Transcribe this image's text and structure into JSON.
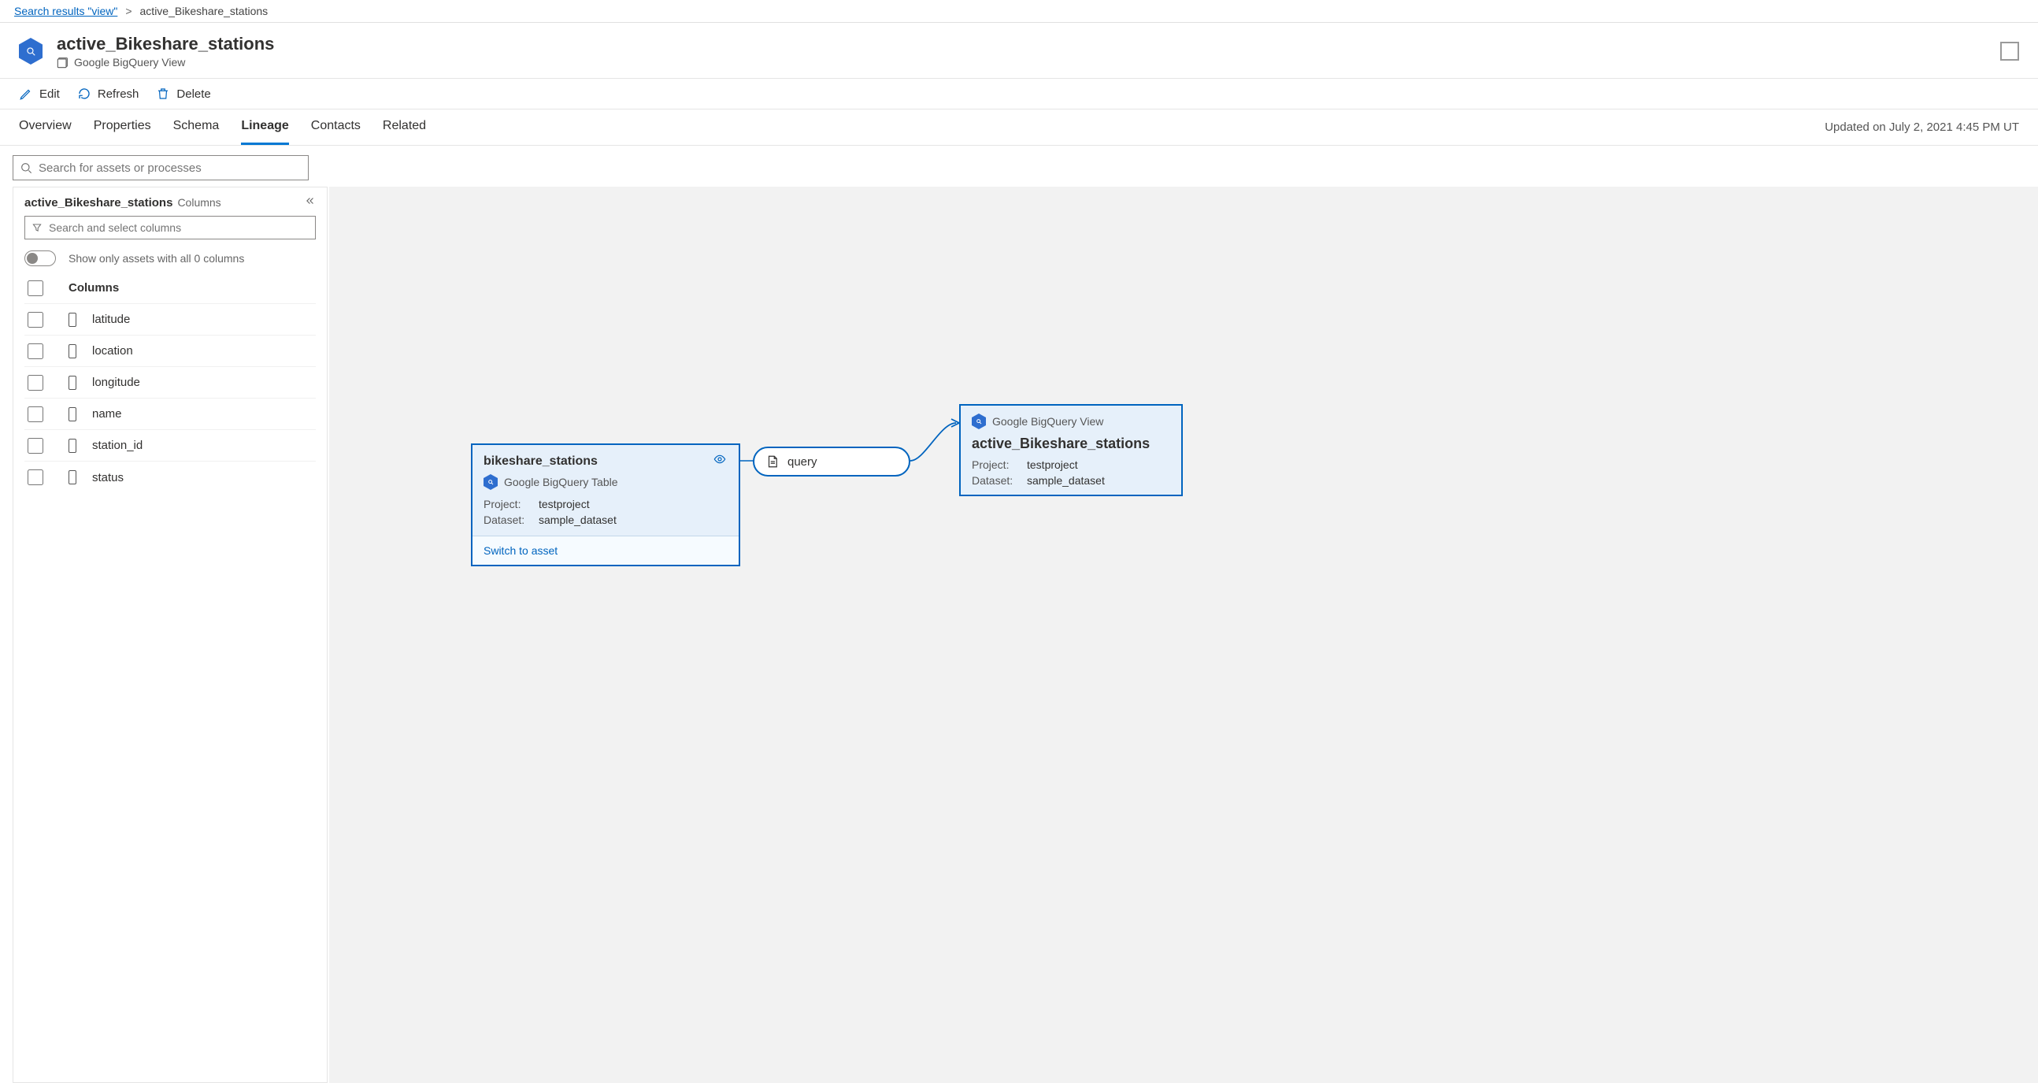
{
  "breadcrumb": {
    "back_label": "Search results \"view\"",
    "current": "active_Bikeshare_stations"
  },
  "asset": {
    "title": "active_Bikeshare_stations",
    "type_label": "Google BigQuery View"
  },
  "actions": {
    "edit": "Edit",
    "refresh": "Refresh",
    "delete": "Delete"
  },
  "tabs": {
    "overview": "Overview",
    "properties": "Properties",
    "schema": "Schema",
    "lineage": "Lineage",
    "contacts": "Contacts",
    "related": "Related"
  },
  "updated_text": "Updated on July 2, 2021 4:45 PM UT",
  "search": {
    "asset_placeholder": "Search for assets or processes",
    "columns_placeholder": "Search and select columns"
  },
  "panel": {
    "title": "active_Bikeshare_stations",
    "subtitle": "Columns",
    "toggle_label": "Show only assets with all 0 columns",
    "columns_header": "Columns",
    "columns": [
      {
        "name": "latitude"
      },
      {
        "name": "location"
      },
      {
        "name": "longitude"
      },
      {
        "name": "name"
      },
      {
        "name": "station_id"
      },
      {
        "name": "status"
      }
    ]
  },
  "lineage": {
    "source": {
      "title": "bikeshare_stations",
      "type": "Google BigQuery Table",
      "project_label": "Project:",
      "project_value": "testproject",
      "dataset_label": "Dataset:",
      "dataset_value": "sample_dataset",
      "switch_label": "Switch to asset"
    },
    "process": {
      "label": "query"
    },
    "target": {
      "type": "Google BigQuery View",
      "title": "active_Bikeshare_stations",
      "project_label": "Project:",
      "project_value": "testproject",
      "dataset_label": "Dataset:",
      "dataset_value": "sample_dataset"
    }
  }
}
